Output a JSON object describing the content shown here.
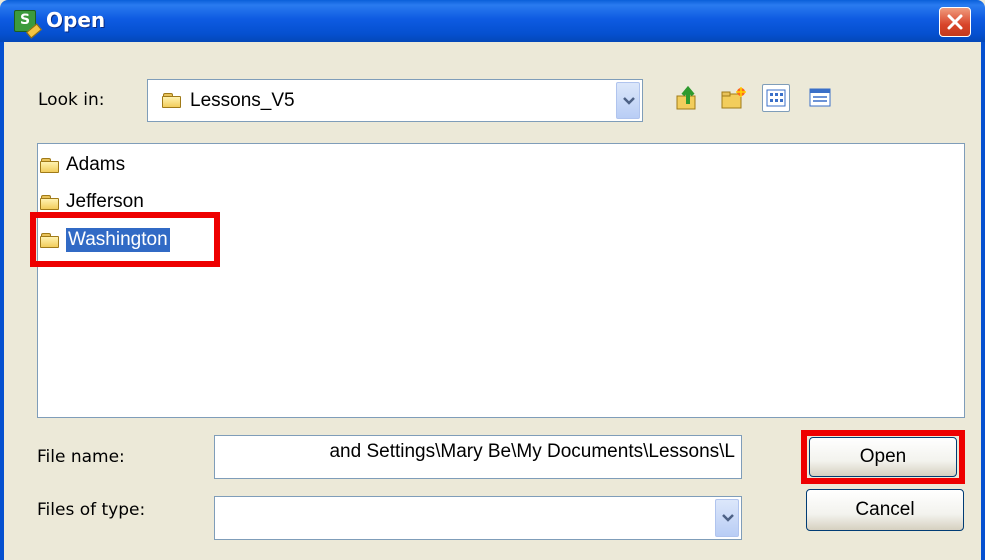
{
  "window": {
    "title": "Open"
  },
  "look_in": {
    "label": "Look in:",
    "value": "Lessons_V5"
  },
  "toolbar": {
    "icons": [
      "up-folder-icon",
      "new-folder-icon",
      "list-view-icon",
      "details-view-icon"
    ]
  },
  "files": [
    {
      "name": "Adams",
      "selected": false
    },
    {
      "name": "Jefferson",
      "selected": false
    },
    {
      "name": "Washington",
      "selected": true
    }
  ],
  "file_name": {
    "label": "File name:",
    "value": "and Settings\\Mary Be\\My Documents\\Lessons\\L"
  },
  "files_of_type": {
    "label": "Files of type:",
    "value": ""
  },
  "buttons": {
    "open": "Open",
    "cancel": "Cancel"
  },
  "colors": {
    "title_bar": "#0550D0",
    "dialog_bg": "#ECE9D8",
    "selection": "#316AC5",
    "highlight_box": "#EE0000"
  }
}
